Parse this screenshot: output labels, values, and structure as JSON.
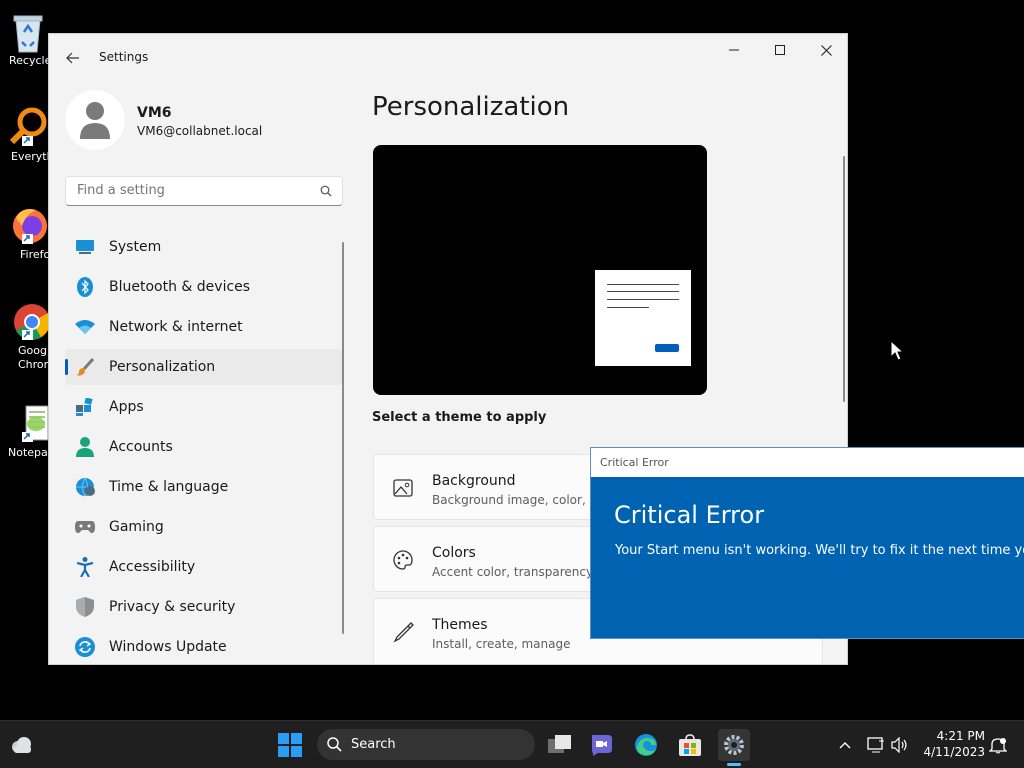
{
  "desktop": {
    "icons": [
      {
        "label": "Recycle"
      },
      {
        "label": "Everyth"
      },
      {
        "label": "Firefo"
      },
      {
        "label": "Goog Chrom"
      },
      {
        "label": "Notepa"
      }
    ]
  },
  "window": {
    "title": "Settings",
    "user": {
      "name": "VM6",
      "email": "VM6@collabnet.local"
    },
    "search_placeholder": "Find a setting",
    "nav": [
      {
        "label": "System"
      },
      {
        "label": "Bluetooth & devices"
      },
      {
        "label": "Network & internet"
      },
      {
        "label": "Personalization"
      },
      {
        "label": "Apps"
      },
      {
        "label": "Accounts"
      },
      {
        "label": "Time & language"
      },
      {
        "label": "Gaming"
      },
      {
        "label": "Accessibility"
      },
      {
        "label": "Privacy & security"
      },
      {
        "label": "Windows Update"
      }
    ],
    "page_title": "Personalization",
    "theme_label": "Select a theme to apply",
    "cards": [
      {
        "title": "Background",
        "subtitle": "Background image, color, slid"
      },
      {
        "title": "Colors",
        "subtitle": "Accent color, transparency eff"
      },
      {
        "title": "Themes",
        "subtitle": "Install, create, manage"
      }
    ]
  },
  "error_dialog": {
    "title_bar": "Critical Error",
    "heading": "Critical Error",
    "message": "Your Start menu isn't working. We'll try to fix it the next time you"
  },
  "taskbar": {
    "search_label": "Search",
    "time": "4:21 PM",
    "date": "4/11/2023"
  },
  "colors": {
    "accent": "#005fb8",
    "error_blue": "#0063b1",
    "taskbar": "#1f1f1f"
  }
}
